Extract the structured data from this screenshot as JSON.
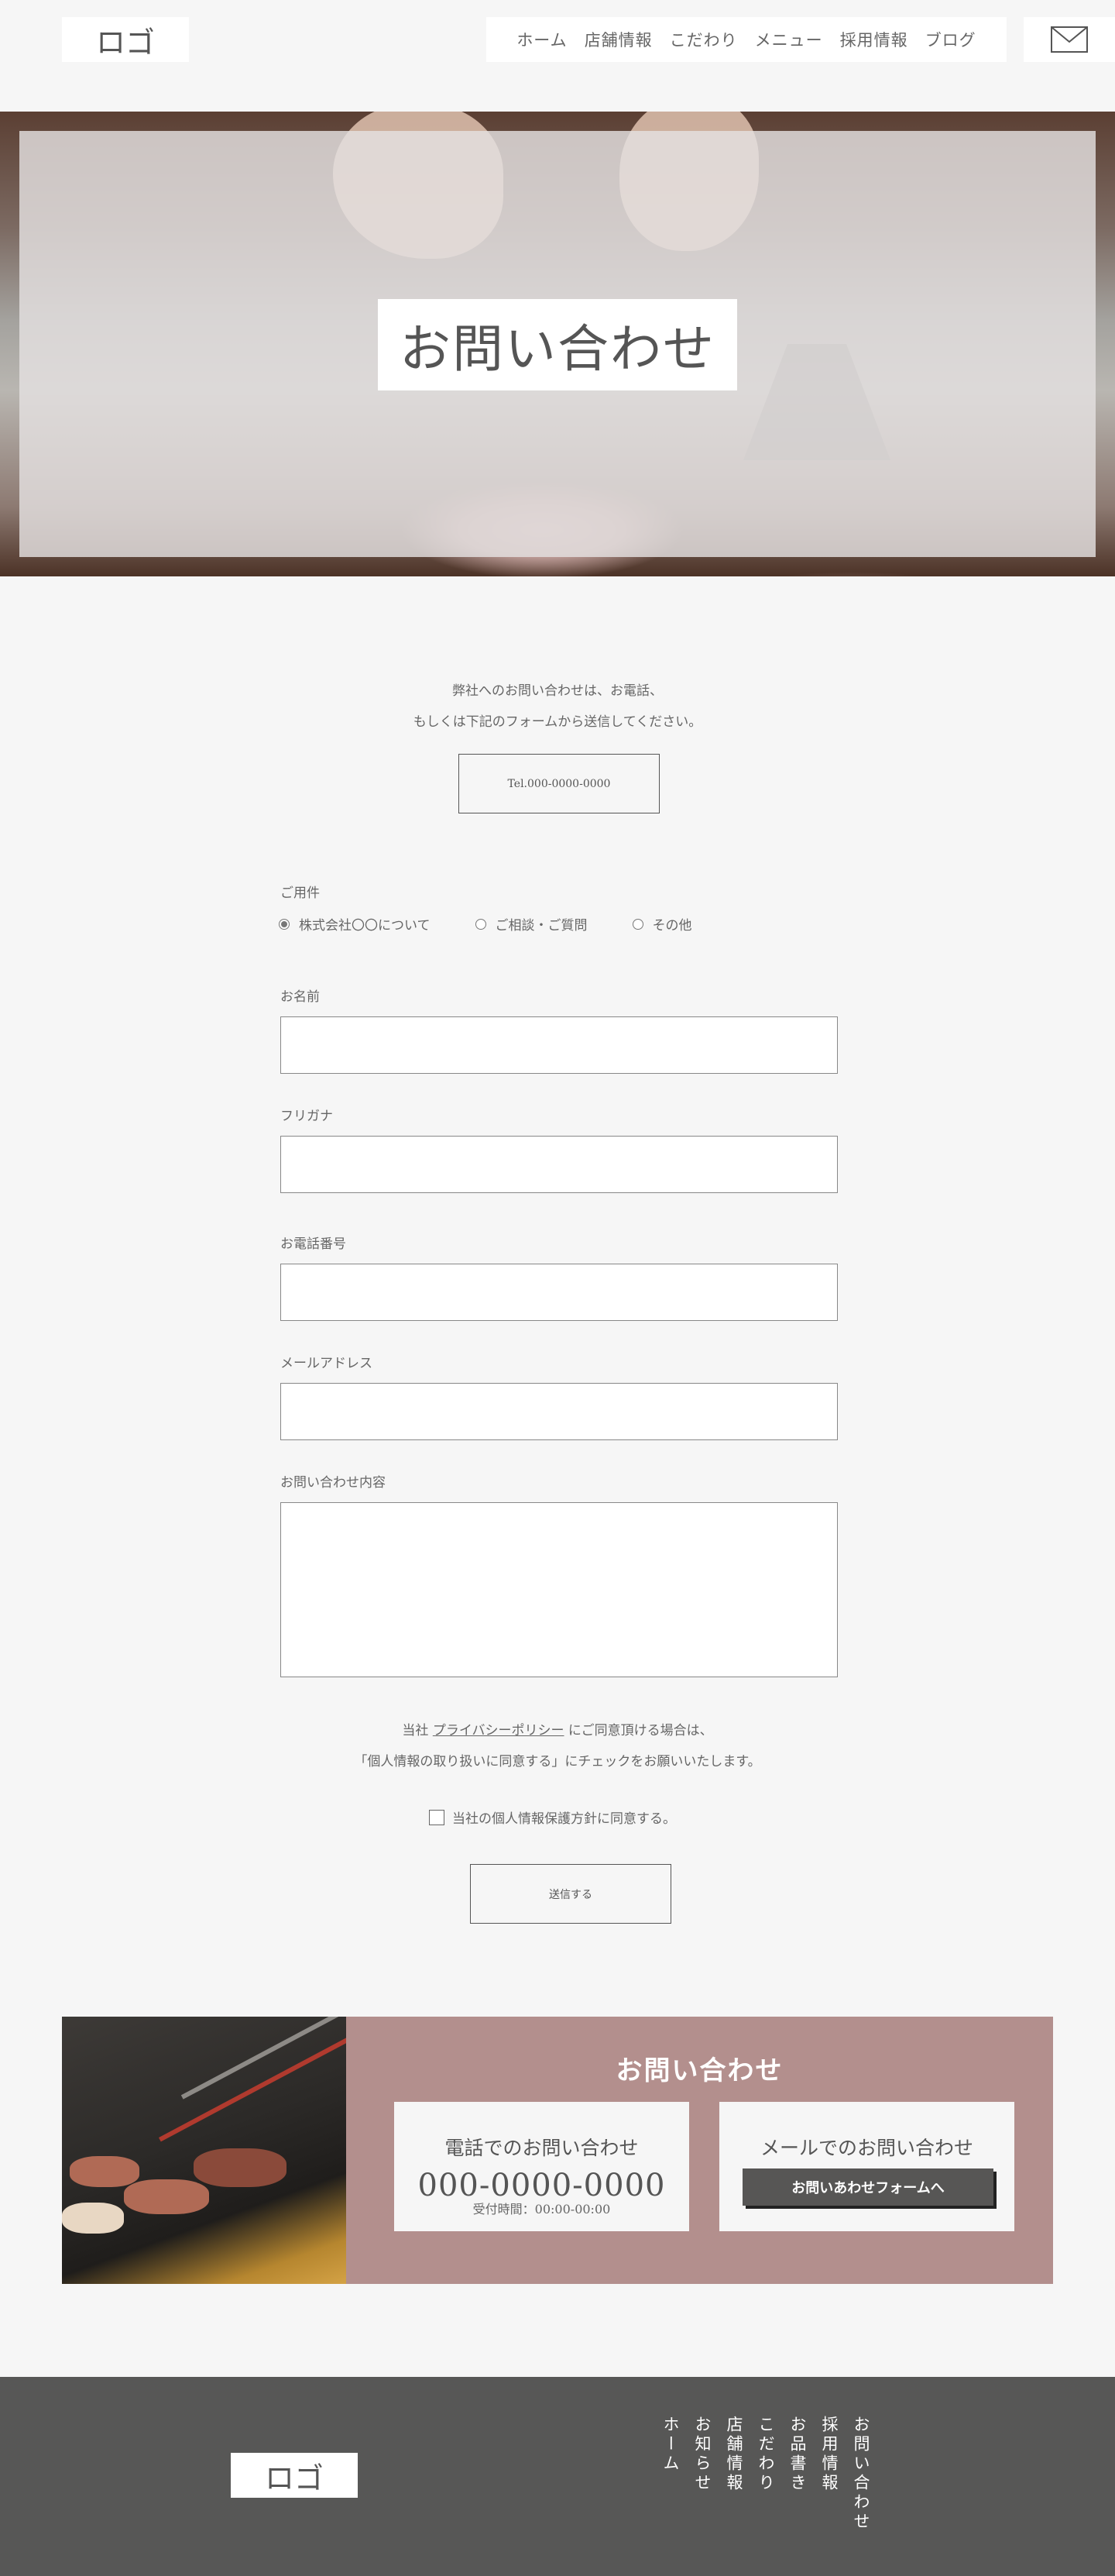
{
  "header": {
    "logo": "ロゴ",
    "nav": [
      "ホーム",
      "店舗情報",
      "こだわり",
      "メニュー",
      "採用情報",
      "ブログ"
    ]
  },
  "hero": {
    "title": "お問い合わせ"
  },
  "intro": {
    "line1": "弊社へのお問い合わせは、お電話、",
    "line2": "もしくは下記のフォームから送信してください。",
    "tel_button": "Tel.000-0000-0000"
  },
  "form": {
    "purpose_label": "ご用件",
    "purpose_options": [
      "株式会社〇〇について",
      "ご相談・ご質問",
      "その他"
    ],
    "purpose_selected": "株式会社〇〇について",
    "name_label": "お名前",
    "kana_label": "フリガナ",
    "phone_label": "お電話番号",
    "email_label": "メールアドレス",
    "message_label": "お問い合わせ内容",
    "privacy_pre": "当社 ",
    "privacy_link": "プライバシーポリシー",
    "privacy_post": " にご同意頂ける場合は、",
    "privacy_line2": "「個人情報の取り扱いに同意する」にチェックをお願いいたします。",
    "agree_label": "当社の個人情報保護方針に同意する。",
    "submit": "送信する"
  },
  "contact": {
    "title": "お問い合わせ",
    "phone_card_title": "電話でのお問い合わせ",
    "phone_number": "000-0000-0000",
    "hours": "受付時間：00:00-00:00",
    "mail_card_title": "メールでのお問い合わせ",
    "mail_button": "お問いあわせフォームへ"
  },
  "footer": {
    "logo": "ロゴ",
    "nav": [
      "ホーム",
      "お知らせ",
      "店舗情報",
      "こだわり",
      "お品書き",
      "採用情報",
      "お問い合わせ"
    ]
  },
  "colors": {
    "accent": "#b38f8d",
    "footer_bg": "#575756",
    "page_bg": "#f6f6f6"
  }
}
